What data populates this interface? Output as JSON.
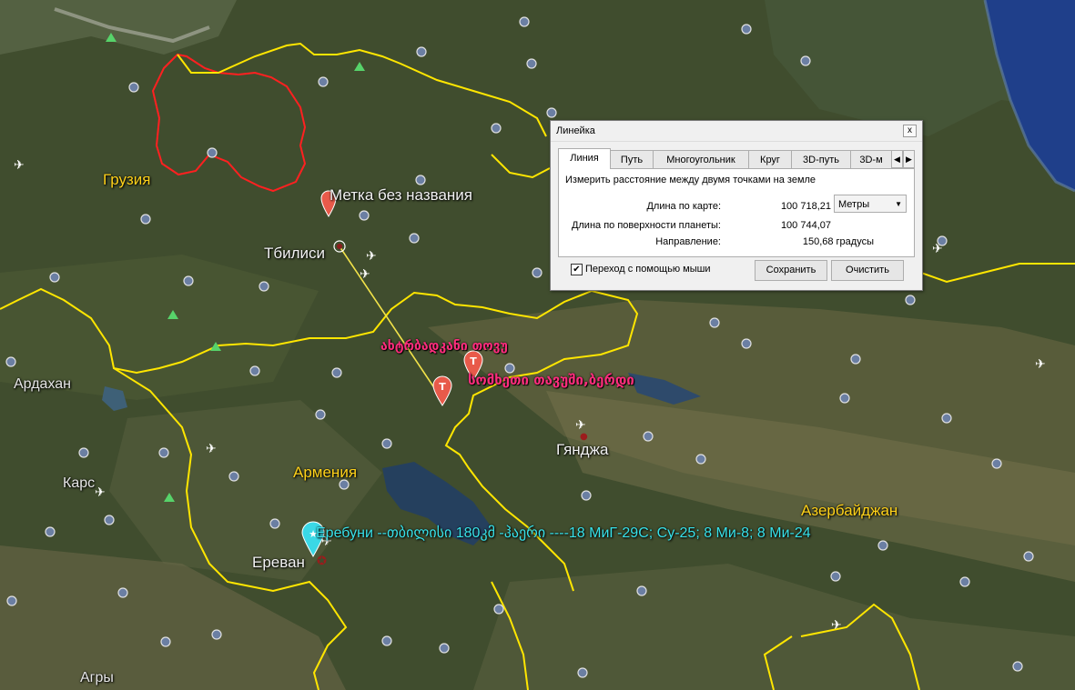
{
  "map": {
    "country_labels": {
      "georgia": "Грузия",
      "armenia": "Армения",
      "azerbaijan": "Азербайджан"
    },
    "city_labels": {
      "tbilisi": "Тбилиси",
      "yerevan": "Ереван",
      "ganja": "Гянджа",
      "ardahan": "Ардахан",
      "kars": "Карс",
      "agri": "Агры"
    },
    "placemarks": {
      "unnamed": "Метка без названия",
      "akhmeta": "ახტრბადკანი თოვუ",
      "georgian_army": "სომხეთი თავუში,ბერდი",
      "erebuni": "Еребуни --თბილისი 180კმ -ჰაერი   ----18 МиГ-29С; Су-25; 8 Ми-8; 8 Ми-24"
    }
  },
  "ruler": {
    "title": "Линейка",
    "close_label": "x",
    "tabs": [
      "Линия",
      "Путь",
      "Многоугольник",
      "Круг",
      "3D-путь",
      "3D-м"
    ],
    "active_tab": "Линия",
    "description": "Измерить расстояние между двумя точками на земле",
    "map_length_label": "Длина по карте:",
    "map_length_value": "100 718,21",
    "unit": "Метры",
    "surface_length_label": "Длина по поверхности планеты:",
    "surface_length_value": "100 744,07",
    "heading_label": "Направление:",
    "heading_value": "150,68 градусы",
    "mouse_nav_label": "Переход с помощью мыши",
    "mouse_nav_checked": true,
    "save_label": "Сохранить",
    "clear_label": "Очистить"
  },
  "colors": {
    "border_yellow": "#ffe600",
    "border_red": "#ff2020",
    "ruler_line": "#f2e34a",
    "sea": "#1f3f8a",
    "lake": "#2e4a6b"
  }
}
